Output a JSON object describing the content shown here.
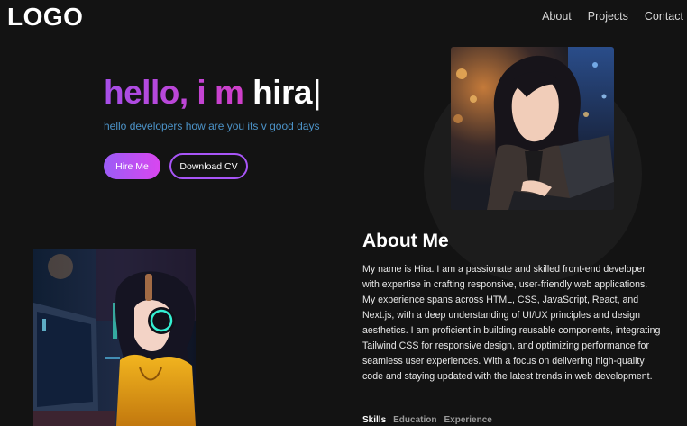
{
  "nav": {
    "logo": "LOGO",
    "links": [
      "About",
      "Projects",
      "Contact"
    ]
  },
  "hero": {
    "greeting": "hello, i m",
    "name": "hira",
    "caret": "|",
    "subtitle": "hello developers how are you its v good days",
    "primary_button": "Hire Me",
    "secondary_button": "Download CV"
  },
  "about": {
    "title": "About Me",
    "body": "My name is Hira. I am a passionate and skilled front-end developer with expertise in crafting responsive, user-friendly web applications. My experience spans across HTML, CSS, JavaScript, React, and Next.js, with a deep understanding of UI/UX principles and design aesthetics. I am proficient in building reusable components, integrating Tailwind CSS for responsive design, and optimizing performance for seamless user experiences. With a focus on delivering high-quality code and staying updated with the latest trends in web development.",
    "tabs": [
      "Skills",
      "Education",
      "Experience"
    ]
  },
  "colors": {
    "background": "#131313",
    "accent_purple": "#a855f7",
    "accent_pink": "#d946ef",
    "subtitle_blue": "#4c93c8"
  }
}
